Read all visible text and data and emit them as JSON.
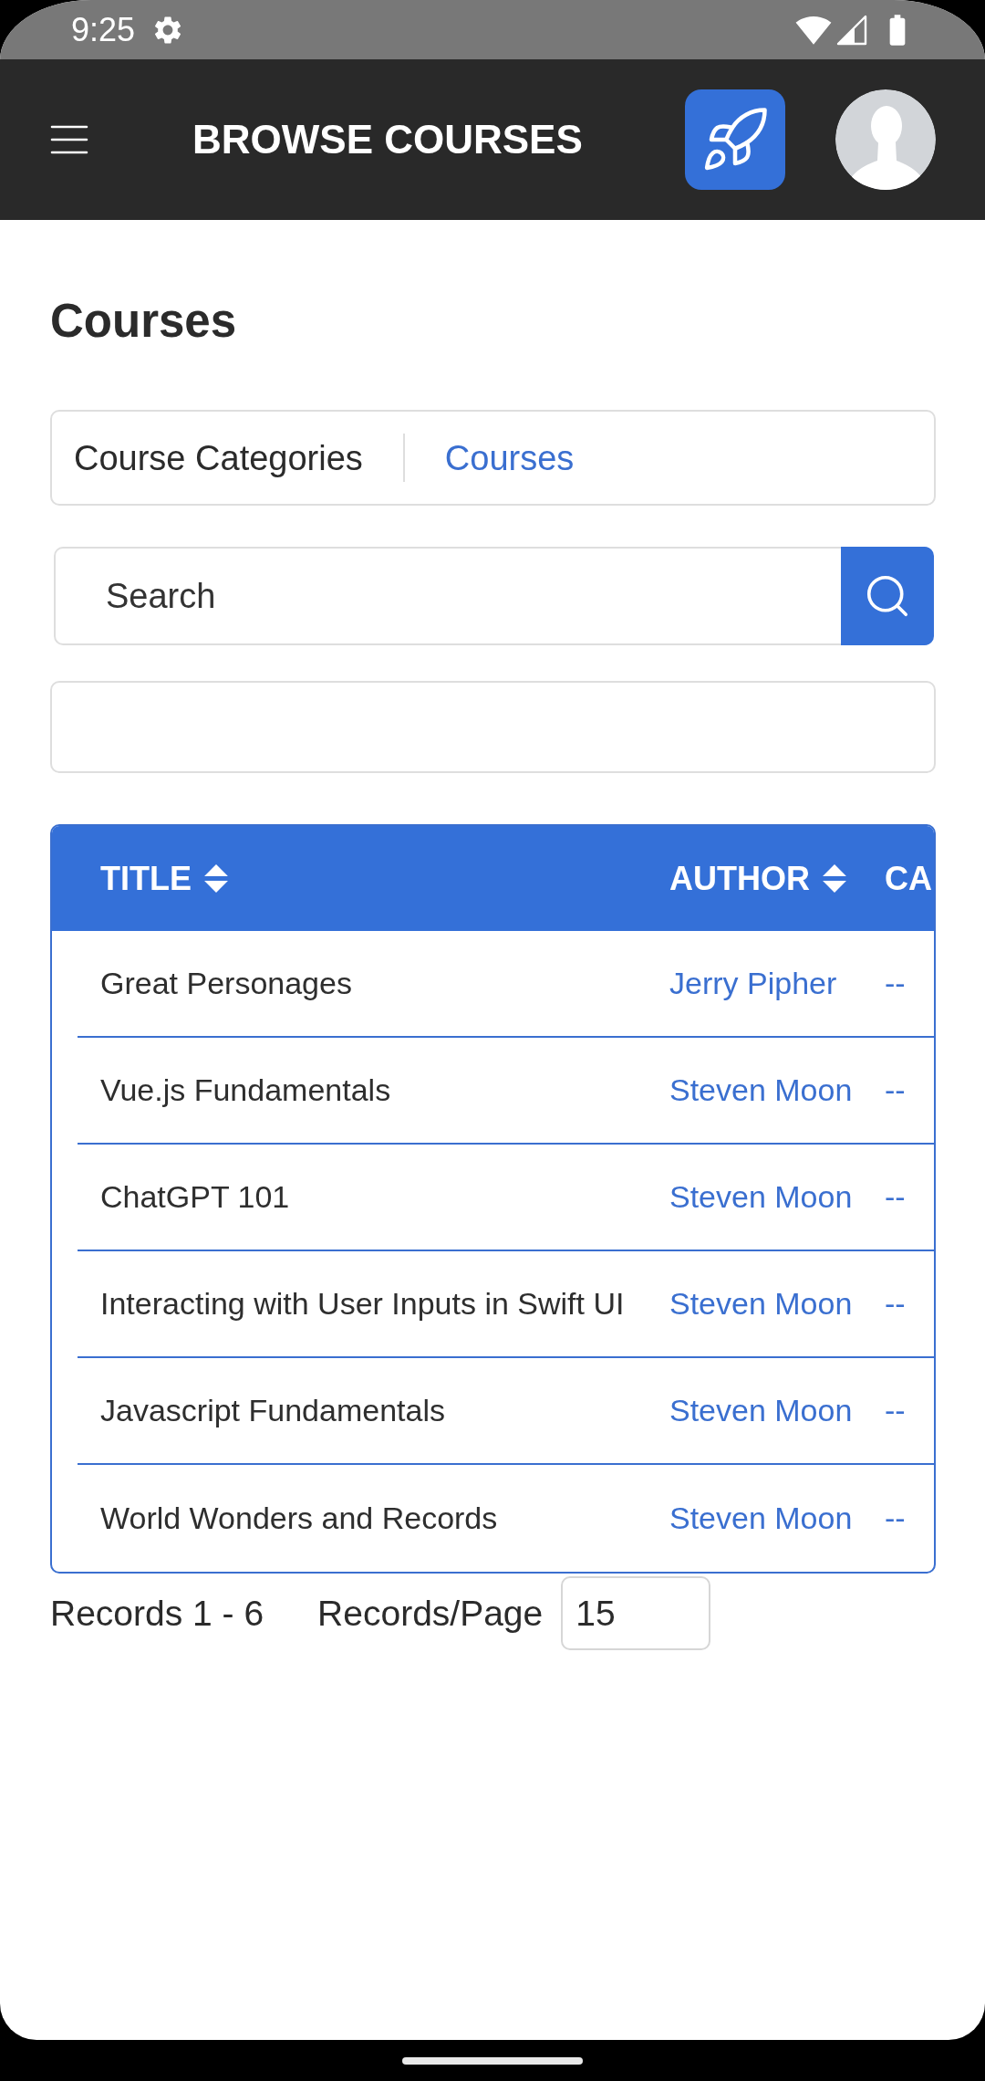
{
  "status_bar": {
    "time": "9:25"
  },
  "header": {
    "title": "BROWSE COURSES"
  },
  "heading": "Courses",
  "breadcrumb": [
    {
      "label": "Course Categories",
      "selected": false
    },
    {
      "label": "Courses",
      "selected": true
    }
  ],
  "search": {
    "placeholder": "Search"
  },
  "table": {
    "columns": [
      {
        "label": "TITLE",
        "sortable": true
      },
      {
        "label": "AUTHOR",
        "sortable": true
      },
      {
        "label": "CA",
        "sortable": false
      }
    ],
    "rows": [
      {
        "title": "Great Personages",
        "author": "Jerry Pipher",
        "column_3": "--"
      },
      {
        "title": "Vue.js Fundamentals",
        "author": "Steven Moon",
        "column_3": "--"
      },
      {
        "title": "ChatGPT 101",
        "author": "Steven Moon",
        "column_3": "--"
      },
      {
        "title": "Interacting with User Inputs in Swift UI",
        "author": "Steven Moon",
        "column_3": "--"
      },
      {
        "title": "Javascript Fundamentals",
        "author": "Steven Moon",
        "column_3": "--"
      },
      {
        "title": "World Wonders and Records",
        "author": "Steven Moon",
        "column_3": "--"
      }
    ]
  },
  "pagination": {
    "records": "Records 1 - 6",
    "page_size_label": "Records/Page",
    "page_size": "15"
  }
}
